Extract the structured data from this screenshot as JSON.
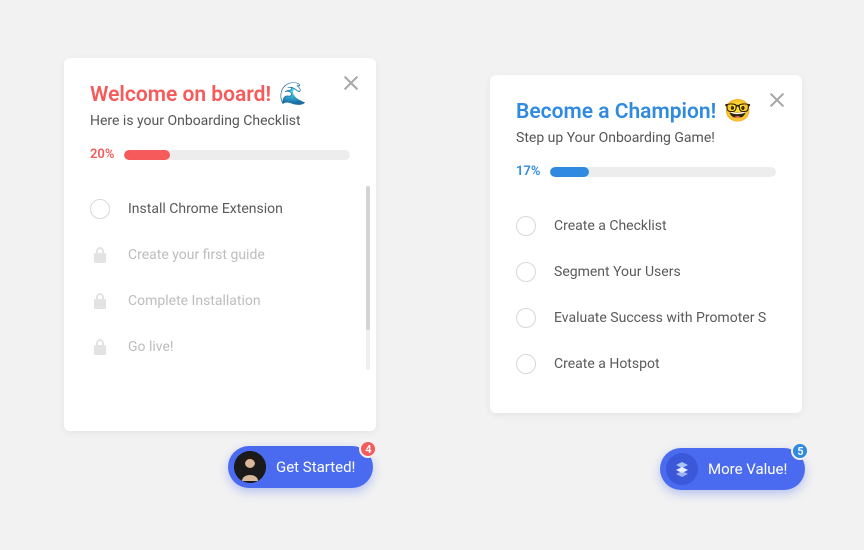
{
  "cards": [
    {
      "title": "Welcome on board!",
      "emoji": "🌊",
      "subtitle": "Here is your Onboarding Checklist",
      "progress_pct_label": "20%",
      "progress_pct": 20,
      "accent": "red",
      "items": [
        {
          "label": "Install Chrome Extension",
          "locked": false
        },
        {
          "label": "Create your first guide",
          "locked": true
        },
        {
          "label": "Complete Installation",
          "locked": true
        },
        {
          "label": "Go live!",
          "locked": true
        }
      ]
    },
    {
      "title": "Become a Champion!",
      "emoji": "🤓",
      "subtitle": "Step up Your Onboarding Game!",
      "progress_pct_label": "17%",
      "progress_pct": 17,
      "accent": "blue",
      "items": [
        {
          "label": "Create a Checklist",
          "locked": false
        },
        {
          "label": "Segment Your Users",
          "locked": false
        },
        {
          "label": "Evaluate Success with Promoter S",
          "locked": false
        },
        {
          "label": "Create a Hotspot",
          "locked": false
        }
      ]
    }
  ],
  "pills": [
    {
      "label": "Get Started!",
      "badge": "4",
      "badge_color": "red",
      "icon": "avatar"
    },
    {
      "label": "More Value!",
      "badge": "5",
      "badge_color": "blue",
      "icon": "layers"
    }
  ]
}
